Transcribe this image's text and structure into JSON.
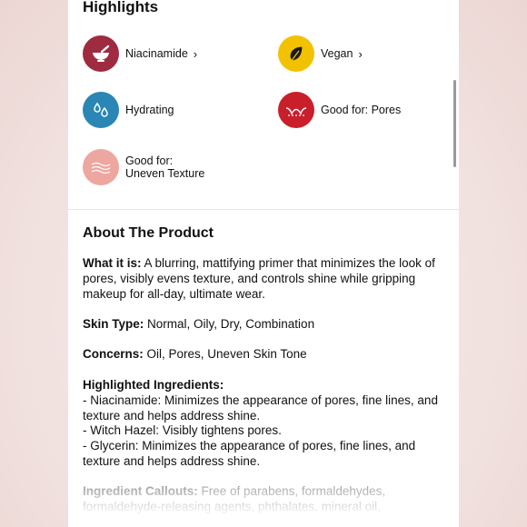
{
  "highlights": {
    "title": "Highlights",
    "items": [
      {
        "label": "Niacinamide",
        "chevron": "›",
        "icon": "mortar-pestle-icon",
        "color": "#9e2b3f"
      },
      {
        "label": "Vegan",
        "chevron": "›",
        "icon": "leaf-icon",
        "color": "#f2c200"
      },
      {
        "label": "Hydrating",
        "icon": "water-drops-icon",
        "color": "#2a86b4"
      },
      {
        "label": "Good for: Pores",
        "icon": "skin-pores-icon",
        "color": "#c91f2b"
      },
      {
        "label_line1": "Good for:",
        "label_line2": "Uneven Texture",
        "icon": "skin-texture-icon",
        "color": "#eea6a0"
      }
    ]
  },
  "about": {
    "title": "About The Product",
    "what_label": "What it is:",
    "what_text": "A blurring, mattifying primer that minimizes the look of pores, visibly evens texture, and controls shine while gripping makeup for all-day, ultimate wear.",
    "skin_label": "Skin Type:",
    "skin_text": "Normal, Oily, Dry, Combination",
    "concerns_label": "Concerns:",
    "concerns_text": "Oil, Pores, Uneven Skin Tone",
    "ingredients_label": "Highlighted Ingredients:",
    "ingredients": [
      "- Niacinamide: Minimizes the appearance of pores, fine lines, and texture and helps address shine.",
      "- Witch Hazel: Visibly tightens pores.",
      "- Glycerin: Minimizes the appearance of pores, fine lines, and texture and helps address shine."
    ],
    "callouts_label": "Ingredient Callouts:",
    "callouts_text": "Free of parabens, formaldehydes, formaldehyde-releasing agents, phthalates, mineral oil,"
  }
}
